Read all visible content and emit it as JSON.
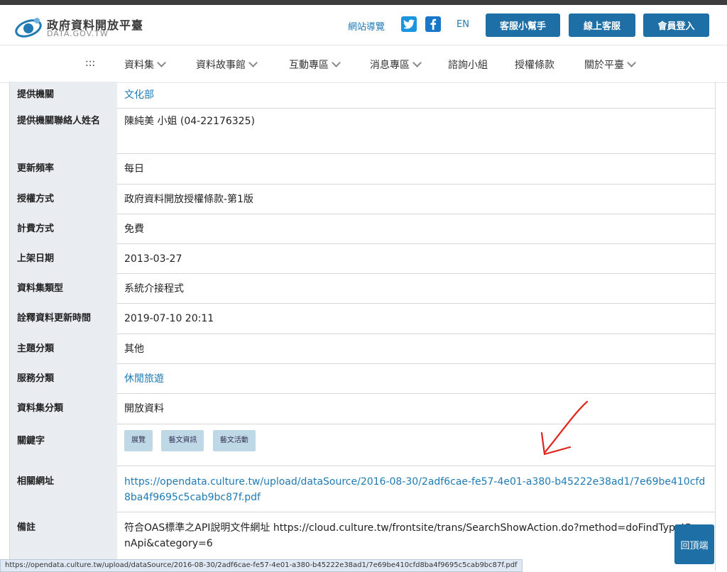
{
  "header": {
    "brand_title": "政府資料開放平臺",
    "brand_sub": "DATA.GOV.TW",
    "sitemap": "網站導覽",
    "lang": "EN",
    "buttons": [
      "客服小幫手",
      "線上客服",
      "會員登入"
    ]
  },
  "nav": {
    "menu_icon": ":::",
    "items": [
      "資料集",
      "資料故事館",
      "互動專區",
      "消息專區",
      "諮詢小組",
      "授權條款",
      "關於平臺"
    ]
  },
  "table": {
    "rows": [
      {
        "label": "提供機關",
        "value": "文化部"
      },
      {
        "label": "提供機關聯絡人姓名",
        "value": "陳純美 小姐 (04-22176325)"
      },
      {
        "label": "更新頻率",
        "value": "每日"
      },
      {
        "label": "授權方式",
        "value": "政府資料開放授權條款-第1版"
      },
      {
        "label": "計費方式",
        "value": "免費"
      },
      {
        "label": "上架日期",
        "value": "2013-03-27"
      },
      {
        "label": "資料集類型",
        "value": "系統介接程式"
      },
      {
        "label": "詮釋資料更新時間",
        "value": "2019-07-10 20:11"
      },
      {
        "label": "主題分類",
        "value": "其他"
      },
      {
        "label": "服務分類",
        "value": "休閒旅遊"
      },
      {
        "label": "資料集分類",
        "value": "開放資料"
      },
      {
        "label": "關鍵字",
        "tags": [
          "展覽",
          "藝文資訊",
          "藝文活動"
        ]
      },
      {
        "label": "相關網址",
        "value": "https://opendata.culture.tw/upload/dataSource/2016-08-30/2adf6cae-fe57-4e01-a380-b45222e38ad1/7e69be410cfd8ba4f9695c5cab9bc87f.pdf"
      },
      {
        "label": "備註",
        "value": "符合OAS標準之API說明文件網址 https://cloud.culture.tw/frontsite/trans/SearchShowAction.do?method=doFindTypeJOpenApi&category=6"
      }
    ]
  },
  "back_to_top": "回頂端",
  "status_url": "https://opendata.culture.tw/upload/dataSource/2016-08-30/2adf6cae-fe57-4e01-a380-b45222e38ad1/7e69be410cfd8ba4f9695c5cab9bc87f.pdf",
  "colors": {
    "accent": "#1e6fa6",
    "link": "#1f7ab5",
    "label_bg": "#e9ecf0",
    "tag_bg": "#bfd8e6",
    "annotation": "#e0251c"
  },
  "icons": [
    "logo-icon",
    "twitter-icon",
    "facebook-icon",
    "chevron-down-icon",
    "red-arrow-annotation"
  ]
}
